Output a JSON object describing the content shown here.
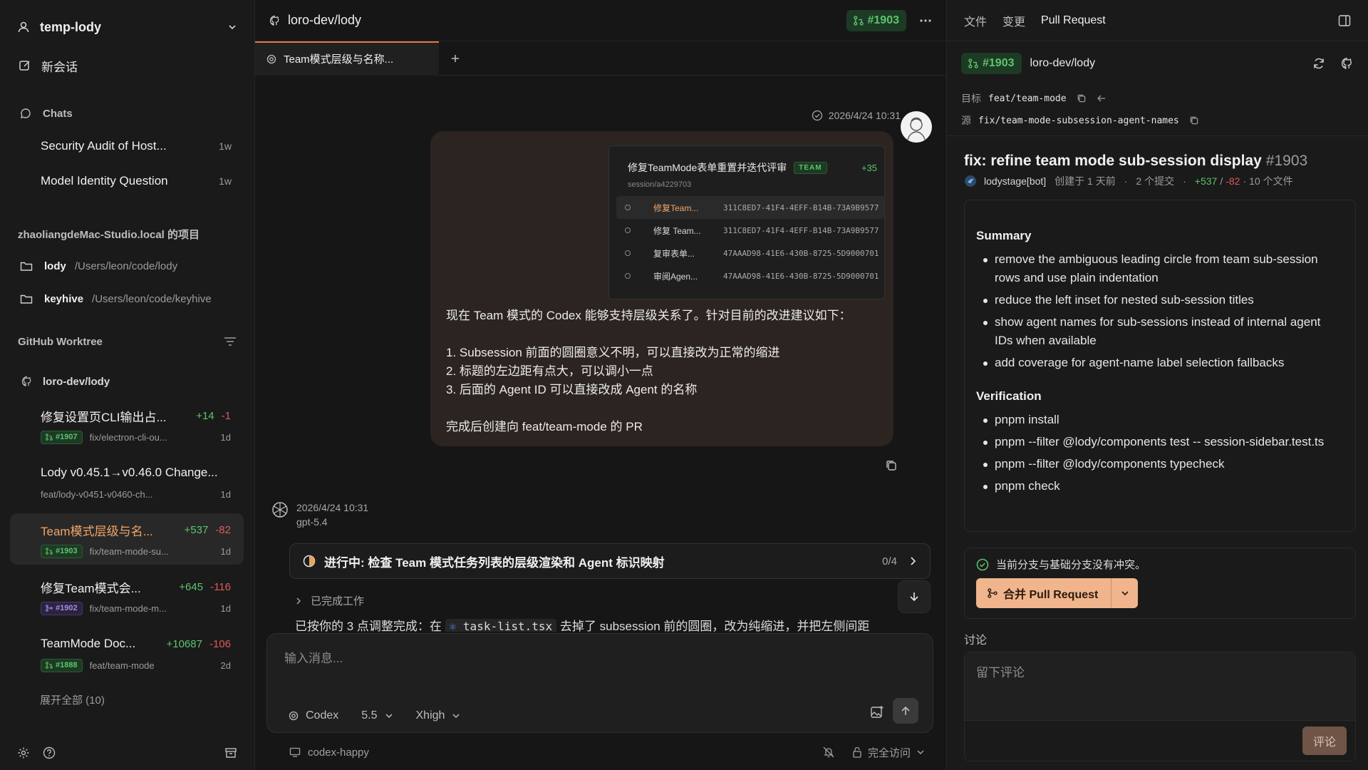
{
  "sidebar": {
    "workspace": "temp-lody",
    "new_chat": "新会话",
    "chats_title": "Chats",
    "chats": [
      {
        "title": "Security Audit of Host...",
        "age": "1w"
      },
      {
        "title": "Model Identity Question",
        "age": "1w"
      }
    ],
    "projects_title": "zhaoliangdeMac-Studio.local 的项目",
    "projects": [
      {
        "name": "lody",
        "path": "/Users/leon/code/lody"
      },
      {
        "name": "keyhive",
        "path": "/Users/leon/code/keyhive"
      }
    ],
    "github_title": "GitHub Worktree",
    "repo": "loro-dev/lody",
    "worktrees": [
      {
        "title": "修复设置页CLI输出占...",
        "plus": "+14",
        "minus": "-1",
        "pr": "#1907",
        "branch": "fix/electron-cli-ou...",
        "age": "1d",
        "pr_color": "green"
      },
      {
        "title": "Lody v0.45.1→v0.46.0 Change...",
        "plus": "",
        "minus": "",
        "pr": "",
        "branch": "feat/lody-v0451-v0460-ch...",
        "age": "1d",
        "pr_color": ""
      },
      {
        "title": "Team模式层级与名...",
        "plus": "+537",
        "minus": "-82",
        "pr": "#1903",
        "branch": "fix/team-mode-su...",
        "age": "1d",
        "pr_color": "green",
        "active": true
      },
      {
        "title": "修复Team模式会...",
        "plus": "+645",
        "minus": "-116",
        "pr": "#1902",
        "branch": "fix/team-mode-m...",
        "age": "1d",
        "pr_color": "purple"
      },
      {
        "title": "TeamMode Doc...",
        "plus": "+10687",
        "minus": "-106",
        "pr": "#1888",
        "branch": "feat/team-mode",
        "age": "2d",
        "pr_color": "green"
      }
    ],
    "expand_all": "展开全部 (10)"
  },
  "center": {
    "repo": "loro-dev/lody",
    "pr": "#1903",
    "tab_label": "Team模式层级与名称...",
    "user_time": "2026/4/24 10:31",
    "thumb": {
      "title": "修复TeamMode表单重置并迭代评审",
      "tag": "TEAM",
      "count": "+35",
      "session": "session/a4229703",
      "rows": [
        {
          "name": "修复Team...",
          "id": "311C8ED7-41F4-4EFF-B14B-73A9B9577"
        },
        {
          "name": "修复 Team...",
          "id": "311C8ED7-41F4-4EFF-B14B-73A9B9577"
        },
        {
          "name": "复审表单...",
          "id": "47AAAD98-41E6-430B-8725-5D9000701"
        },
        {
          "name": "审阅Agen...",
          "id": "47AAAD98-41E6-430B-8725-5D9000701"
        }
      ]
    },
    "message": {
      "line1": "现在 Team 模式的 Codex 能够支持层级关系了。针对目前的改进建议如下：",
      "item1": "1. Subsession 前面的圆圈意义不明，可以直接改为正常的缩进",
      "item2": "2. 标题的左边距有点大，可以调小一点",
      "item3": "3. 后面的 Agent ID 可以直接改成 Agent 的名称",
      "closing": "完成后创建向 feat/team-mode 的 PR"
    },
    "assistant_time": "2026/4/24 10:31",
    "assistant_model": "gpt-5.4",
    "task": {
      "title": "进行中: 检查 Team 模式任务列表的层级渲染和 Agent 标识映射",
      "progress": "0/4"
    },
    "done_label": "已完成工作",
    "partial_pre": "已按你的 3 点调整完成：在",
    "partial_code": "task-list.tsx",
    "partial_post": "去掉了 subsession 前的圆圈，改为纯缩进，并把左侧间距",
    "composer_placeholder": "输入消息...",
    "agent": "Codex",
    "version": "5.5",
    "effort": "Xhigh",
    "footer_branch": "codex-happy",
    "access": "完全访问"
  },
  "right": {
    "tabs": [
      "文件",
      "变更",
      "Pull Request"
    ],
    "pr": "#1903",
    "repo": "loro-dev/lody",
    "target_label": "目标",
    "target_branch": "feat/team-mode",
    "source_label": "源",
    "source_branch": "fix/team-mode-subsession-agent-names",
    "title": "fix: refine team mode sub-session display",
    "title_num": "#1903",
    "author": "lodystage[bot]",
    "created": "创建于 1 天前",
    "commits": "2 个提交",
    "additions": "+537",
    "deletions": "-82",
    "files": "10 个文件",
    "summary_title": "Summary",
    "summary": [
      "remove the ambiguous leading circle from team sub-session rows and use plain indentation",
      "reduce the left inset for nested sub-session titles",
      "show agent names for sub-sessions instead of internal agent IDs when available",
      "add coverage for agent-name label selection fallbacks"
    ],
    "verification_title": "Verification",
    "verification": [
      "pnpm install",
      "pnpm --filter @lody/components test -- session-sidebar.test.ts",
      "pnpm --filter @lody/components typecheck",
      "pnpm check"
    ],
    "no_conflict": "当前分支与基础分支没有冲突。",
    "merge_label": "合并 Pull Request",
    "discussion": "讨论",
    "comment_placeholder": "留下评论",
    "comment_btn": "评论"
  },
  "colors": {
    "accent": "#e07b3c",
    "green": "#5cc46e",
    "red": "#e0585a",
    "purple": "#a98ae8"
  }
}
